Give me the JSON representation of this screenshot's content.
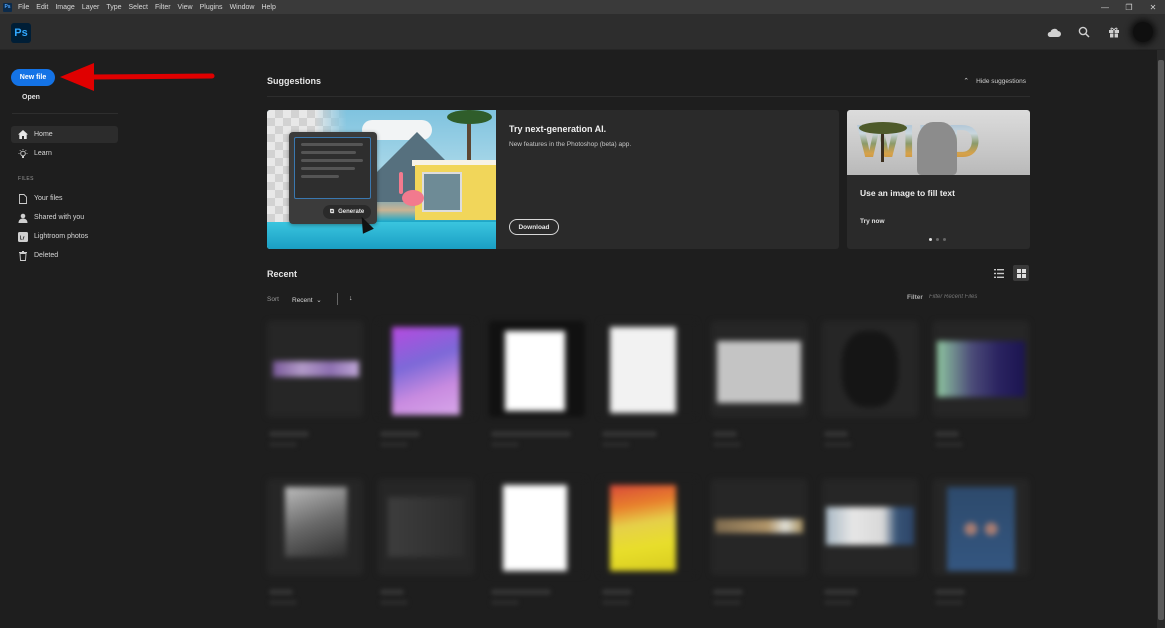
{
  "menubar": {
    "app_icon": "Ps",
    "items": [
      "File",
      "Edit",
      "Image",
      "Layer",
      "Type",
      "Select",
      "Filter",
      "View",
      "Plugins",
      "Window",
      "Help"
    ],
    "window_controls": [
      "minimize-icon",
      "restore-icon",
      "close-icon"
    ]
  },
  "appbar": {
    "logo": "Ps",
    "icons": [
      "cloud-icon",
      "search-icon",
      "gift-icon",
      "avatar"
    ]
  },
  "sidebar": {
    "new_file": "New file",
    "open": "Open",
    "nav": [
      {
        "label": "Home",
        "icon": "home-icon",
        "active": true
      },
      {
        "label": "Learn",
        "icon": "lightbulb-icon",
        "active": false
      }
    ],
    "files_section": "FILES",
    "files": [
      {
        "label": "Your files",
        "icon": "file-icon"
      },
      {
        "label": "Shared with you",
        "icon": "shared-user-icon"
      },
      {
        "label": "Lightroom photos",
        "icon": "lightroom-icon"
      },
      {
        "label": "Deleted",
        "icon": "trash-icon"
      }
    ]
  },
  "annotation": {
    "arrow_color": "#e00000",
    "points_to": "New file"
  },
  "suggestions": {
    "title": "Suggestions",
    "hide_label": "Hide suggestions",
    "ai_card": {
      "title": "Try next-generation AI.",
      "description": "New features in the Photoshop (beta) app.",
      "button": "Download",
      "generate_label": "Generate"
    },
    "fill_card": {
      "image_word": "WILD",
      "title": "Use an image to fill text",
      "cta": "Try now",
      "carousel_pages": 3,
      "carousel_active": 1
    }
  },
  "recent": {
    "title": "Recent",
    "sort_label": "Sort",
    "sort_value": "Recent",
    "sort_direction": "↓",
    "filter_label": "Filter",
    "filter_placeholder": "Filter Recent Files",
    "view_modes": [
      "list",
      "grid"
    ],
    "active_view": "grid",
    "files": [
      {
        "thumb": "dark-banner-purple"
      },
      {
        "thumb": "purple-gradient-portrait"
      },
      {
        "thumb": "white-page"
      },
      {
        "thumb": "white-document"
      },
      {
        "thumb": "gray-landscape"
      },
      {
        "thumb": "dark-portrait"
      },
      {
        "thumb": "green-navy-landscape"
      },
      {
        "thumb": "gray-photo"
      },
      {
        "thumb": "dark-layout"
      },
      {
        "thumb": "white-page"
      },
      {
        "thumb": "colorful-yellow-poster"
      },
      {
        "thumb": "tan-banner"
      },
      {
        "thumb": "white-blue-landscape"
      },
      {
        "thumb": "blue-portrait"
      }
    ]
  },
  "colors": {
    "accent": "#1473e6",
    "background": "#1e1e1e",
    "card": "#2a2a2a",
    "menubar": "#3a3a3a"
  }
}
